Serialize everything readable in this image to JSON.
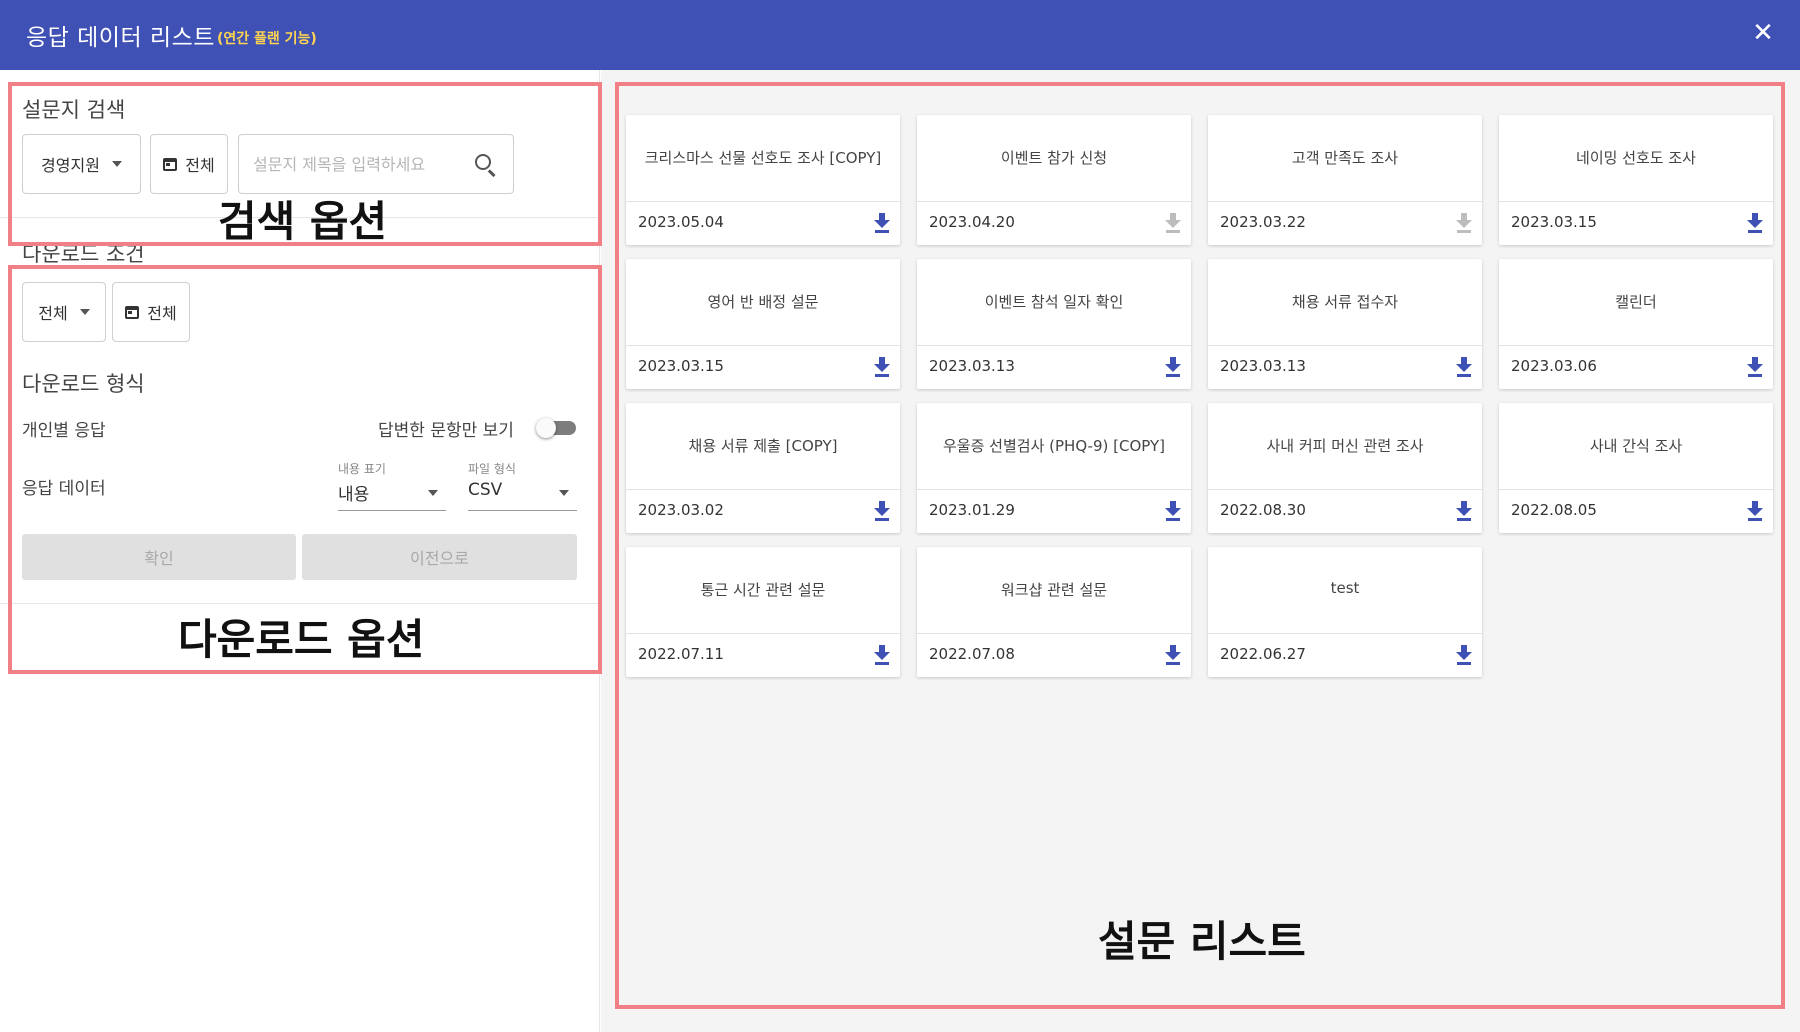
{
  "header": {
    "title": "응답 데이터 리스트",
    "subtitle": "(연간 플랜 기능)",
    "close_icon": "close-icon"
  },
  "search": {
    "label": "설문지 검색",
    "department": "경영지원",
    "date_filter": "전체",
    "placeholder": "설문지 제목을 입력하세요"
  },
  "download_condition": {
    "label": "다운로드 조건",
    "filter": "전체",
    "date_filter": "전체"
  },
  "download_format": {
    "label": "다운로드 형식",
    "individual_label": "개인별 응답",
    "toggle_label": "답변한 문항만 보기",
    "toggle_on": false,
    "data_label": "응답 데이터",
    "content_caption": "내용 표기",
    "content_value": "내용",
    "file_caption": "파일 형식",
    "file_value": "CSV",
    "confirm": "확인",
    "back": "이전으로"
  },
  "annotations": {
    "search_options": "검색 옵션",
    "download_options": "다운로드 옵션",
    "survey_list": "설문 리스트"
  },
  "colors": {
    "header": "#3f51b5",
    "accent_download": "#3f51b5",
    "disabled_download": "#bdbdbd",
    "annotation_border": "#f07f86"
  },
  "surveys": [
    {
      "title": "크리스마스 선물 선호도 조사 [COPY]",
      "date": "2023.05.04",
      "download_enabled": true
    },
    {
      "title": "이벤트 참가 신청",
      "date": "2023.04.20",
      "download_enabled": false
    },
    {
      "title": "고객 만족도 조사",
      "date": "2023.03.22",
      "download_enabled": false
    },
    {
      "title": "네이밍 선호도 조사",
      "date": "2023.03.15",
      "download_enabled": true
    },
    {
      "title": "영어 반 배정 설문",
      "date": "2023.03.15",
      "download_enabled": true
    },
    {
      "title": "이벤트 참석 일자 확인",
      "date": "2023.03.13",
      "download_enabled": true
    },
    {
      "title": "채용 서류 접수자",
      "date": "2023.03.13",
      "download_enabled": true
    },
    {
      "title": "캘린더",
      "date": "2023.03.06",
      "download_enabled": true
    },
    {
      "title": "채용 서류 제출 [COPY]",
      "date": "2023.03.02",
      "download_enabled": true
    },
    {
      "title": "우울증 선별검사 (PHQ-9) [COPY]",
      "date": "2023.01.29",
      "download_enabled": true
    },
    {
      "title": "사내 커피 머신 관련 조사",
      "date": "2022.08.30",
      "download_enabled": true
    },
    {
      "title": "사내 간식 조사",
      "date": "2022.08.05",
      "download_enabled": true
    },
    {
      "title": "통근 시간 관련 설문",
      "date": "2022.07.11",
      "download_enabled": true
    },
    {
      "title": "워크샵 관련 설문",
      "date": "2022.07.08",
      "download_enabled": true
    },
    {
      "title": "test",
      "date": "2022.06.27",
      "download_enabled": true
    }
  ]
}
